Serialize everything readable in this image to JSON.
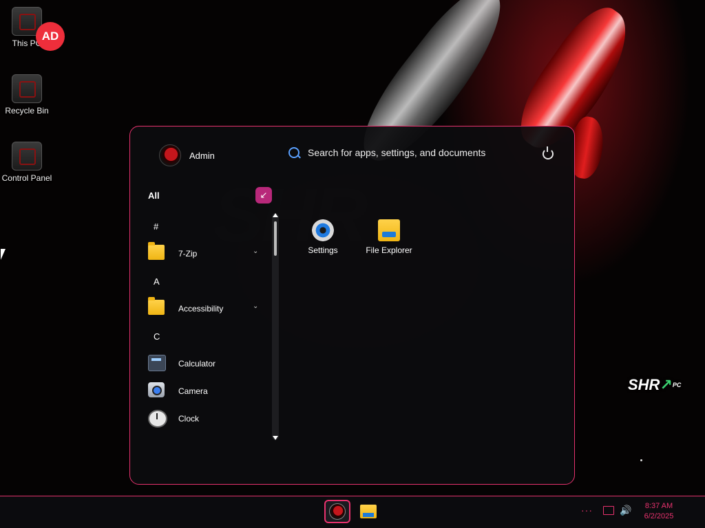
{
  "desktop": {
    "icons": [
      {
        "label": "This PC"
      },
      {
        "label": "Recycle Bin"
      },
      {
        "label": "Control Panel"
      }
    ],
    "badge": "AD",
    "wallpaper_watermark": "SHR",
    "corner_watermark": {
      "brand": "SHR",
      "suffix": "PC"
    }
  },
  "start_menu": {
    "user_name": "Admin",
    "search_placeholder": "Search for apps, settings, and documents",
    "all_label": "All",
    "apps": [
      {
        "type": "letter",
        "label": "#"
      },
      {
        "type": "folder",
        "label": "7-Zip",
        "icon": "folder-icon",
        "expandable": true
      },
      {
        "type": "letter",
        "label": "A"
      },
      {
        "type": "folder",
        "label": "Accessibility",
        "icon": "folder-icon",
        "expandable": true
      },
      {
        "type": "letter",
        "label": "C"
      },
      {
        "type": "app",
        "label": "Calculator",
        "icon": "calculator-icon"
      },
      {
        "type": "app",
        "label": "Camera",
        "icon": "camera-icon"
      },
      {
        "type": "app",
        "label": "Clock",
        "icon": "clock-icon"
      }
    ],
    "pinned": [
      {
        "label": "Settings",
        "icon": "gear-icon"
      },
      {
        "label": "File Explorer",
        "icon": "file-explorer-icon"
      }
    ]
  },
  "taskbar": {
    "time": "8:37 AM",
    "date": "6/2/2025"
  },
  "colors": {
    "accent": "#e8326e",
    "badge": "#ee2e3b"
  }
}
